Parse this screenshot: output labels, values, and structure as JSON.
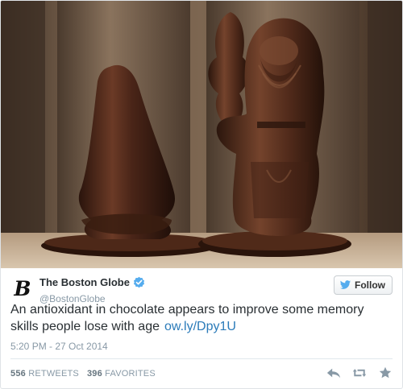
{
  "tweet": {
    "author": {
      "display_name": "The Boston Globe",
      "screen_name": "@BostonGlobe",
      "avatar_glyph": "B",
      "verified": true
    },
    "follow_label": "Follow",
    "text": "An antioxidant in chocolate appears to improve some memory skills people lose with age",
    "link_text": "ow.ly/Dpy1U",
    "timestamp": "5:20 PM - 27 Oct 2014",
    "retweets_count": "556",
    "retweets_label": "RETWEETS",
    "favorites_count": "396",
    "favorites_label": "FAVORITES",
    "photo_description_icon": "photo-chocolate-figures",
    "actions": [
      "reply-icon",
      "retweet-icon",
      "favorite-icon"
    ]
  },
  "colors": {
    "link": "#2b7bb9",
    "verified": "#55acee",
    "meta": "#8899a6",
    "text": "#292f33"
  }
}
